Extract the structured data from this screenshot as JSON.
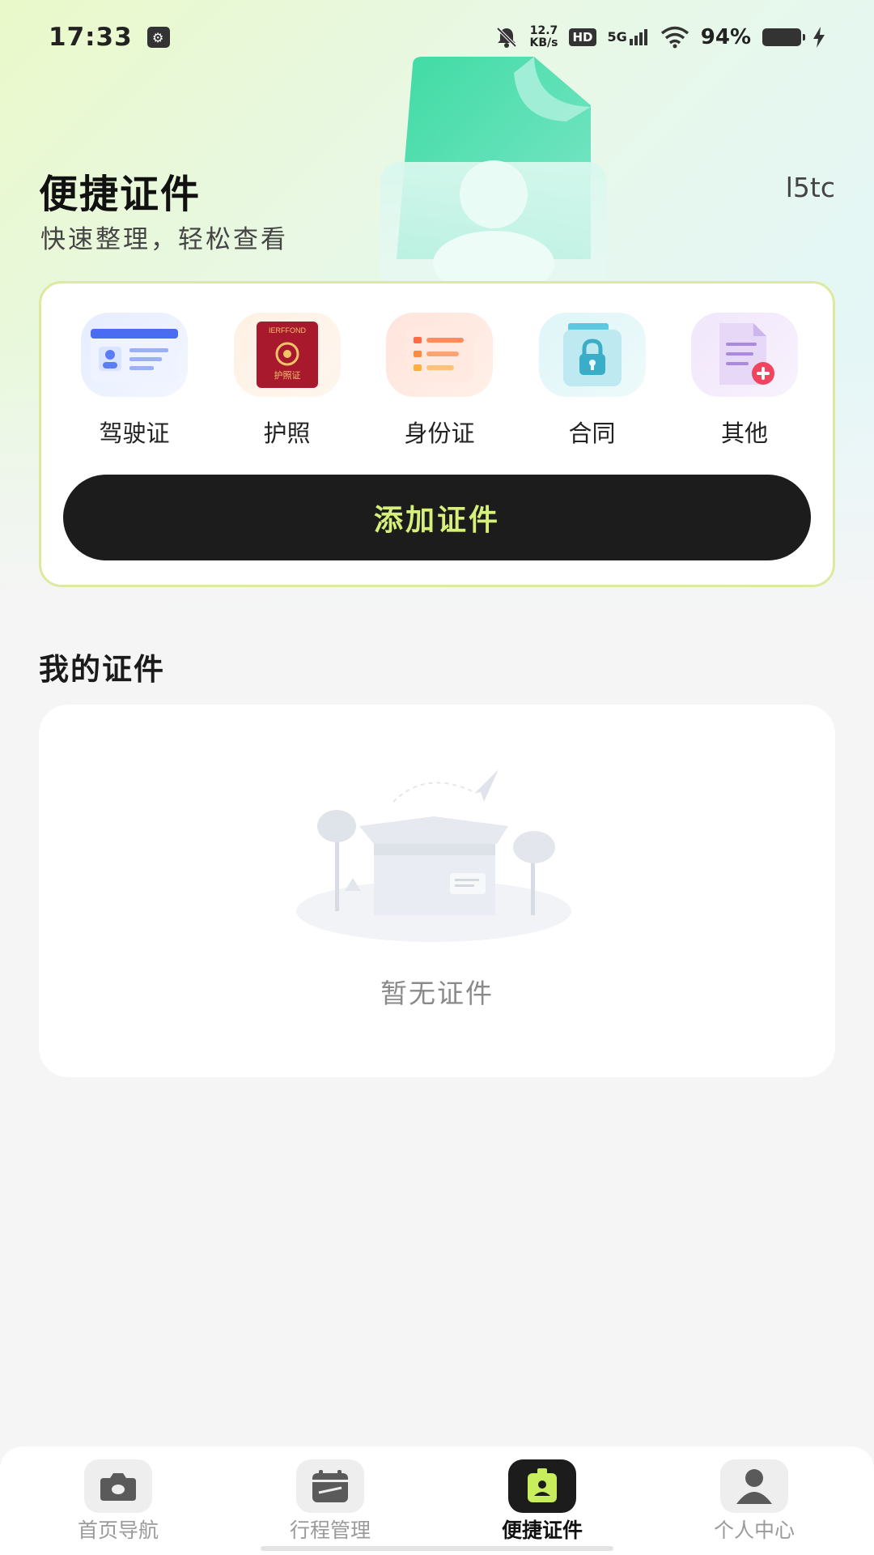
{
  "status_bar": {
    "time": "17:33",
    "net_speed_value": "12.7",
    "net_speed_unit": "KB/s",
    "hd": "HD",
    "signal": "5G",
    "battery": "94%"
  },
  "header": {
    "title": "便捷证件",
    "subtitle": "快速整理，轻松查看",
    "corner_tag": "l5tc"
  },
  "doc_types": [
    {
      "label": "驾驶证",
      "icon": "driver-license-icon"
    },
    {
      "label": "护照",
      "icon": "passport-icon"
    },
    {
      "label": "身份证",
      "icon": "id-card-icon"
    },
    {
      "label": "合同",
      "icon": "contract-lock-icon"
    },
    {
      "label": "其他",
      "icon": "other-document-icon"
    }
  ],
  "passport_text": {
    "top": "IERFFOND",
    "bottom": "护照证"
  },
  "add_button": "添加证件",
  "my_docs": {
    "title": "我的证件",
    "empty_text": "暂无证件"
  },
  "nav": [
    {
      "label": "首页导航",
      "icon": "camera-icon",
      "active": false
    },
    {
      "label": "行程管理",
      "icon": "calendar-icon",
      "active": false
    },
    {
      "label": "便捷证件",
      "icon": "badge-icon",
      "active": true
    },
    {
      "label": "个人中心",
      "icon": "person-icon",
      "active": false
    }
  ],
  "colors": {
    "accent_text": "#d6f07a",
    "dark": "#1c1c1c",
    "card_border": "#dcea9d"
  }
}
